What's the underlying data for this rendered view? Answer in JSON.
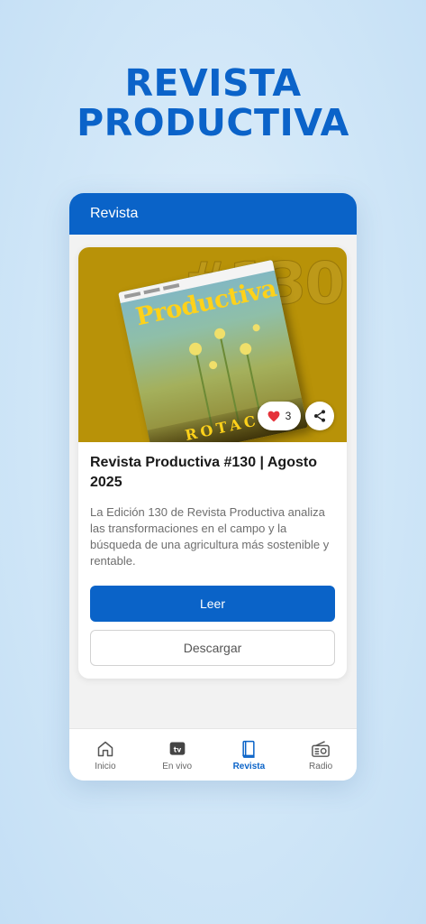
{
  "hero": {
    "line1": "REVISTA",
    "line2": "PRODUCTIVA"
  },
  "header": {
    "title": "Revista"
  },
  "card": {
    "cover": {
      "bg_number": "#130",
      "mag_name": "Productiva",
      "mag_rotation_text": "ROTAC",
      "bg_color": "#b89208"
    },
    "likes": "3",
    "title": "Revista Productiva #130 | Agosto 2025",
    "description": "La Edición 130 de Revista Productiva analiza las transformaciones en el campo y la búsqueda de una agricultura más sostenible y rentable.",
    "read_label": "Leer",
    "download_label": "Descargar"
  },
  "nav": {
    "items": [
      {
        "label": "Inicio",
        "icon": "home-icon"
      },
      {
        "label": "En vivo",
        "icon": "tv-icon"
      },
      {
        "label": "Revista",
        "icon": "book-icon",
        "active": true
      },
      {
        "label": "Radio",
        "icon": "radio-icon"
      }
    ]
  },
  "colors": {
    "brand": "#0a63c8",
    "heart": "#e5323a"
  }
}
